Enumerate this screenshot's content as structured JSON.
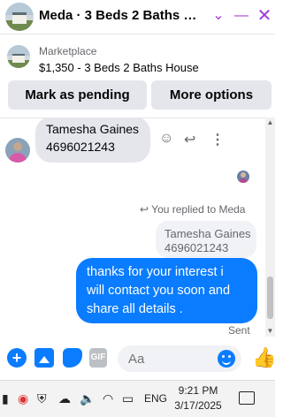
{
  "header": {
    "title": "Meda · 3 Beds 2 Baths Ho...",
    "icons": [
      "chevron-down-icon",
      "minimize-icon",
      "close-icon"
    ]
  },
  "listing": {
    "label": "Marketplace",
    "title": "$1,350 - 3 Beds 2 Baths House"
  },
  "actions": {
    "mark_pending": "Mark as pending",
    "more_options": "More options"
  },
  "thread": {
    "incoming": {
      "name": "Tamesha Gaines",
      "phone": "4696021243"
    },
    "reply_note": "You replied to Meda",
    "quoted": {
      "name": "Tamesha Gaines",
      "phone": "4696021243"
    },
    "outgoing_lines": [
      "thanks for your interest i",
      "will contact you soon and",
      "share all details ."
    ],
    "status": "Sent"
  },
  "composer": {
    "placeholder": "Aa",
    "gif_label": "GIF"
  },
  "taskbar": {
    "language": "ENG",
    "time": "9:21 PM",
    "date": "3/17/2025"
  },
  "colors": {
    "accent": "#0a7cff",
    "header_controls": "#a23bd6",
    "bubble_incoming": "#e4e6eb"
  }
}
